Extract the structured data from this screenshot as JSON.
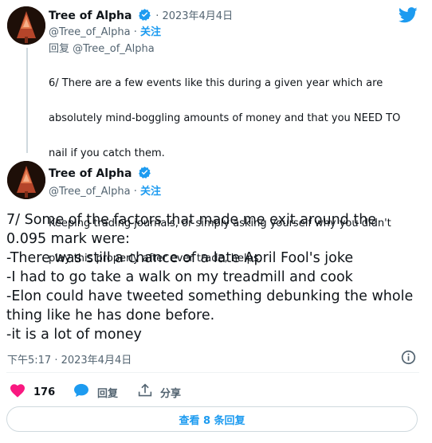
{
  "reply_tweet": {
    "author_name": "Tree of Alpha",
    "handle": "@Tree_of_Alpha",
    "date": "2023年4月4日",
    "follow_label": "关注",
    "replying_to_label": "回复",
    "replying_to_handle": "@Tree_of_Alpha",
    "text_lines": [
      "6/ There are a few events like this during a given year which are",
      "absolutely mind-boggling amounts of money and that you NEED TO",
      "nail if you catch them.",
      "",
      "Keeping trading journals, or simply asking yourself why you didn't",
      "play this properly after ever trade, helps."
    ]
  },
  "main_tweet": {
    "author_name": "Tree of Alpha",
    "handle": "@Tree_of_Alpha",
    "follow_label": "关注",
    "text_lines": [
      "7/ Some of the factors that made me exit around the",
      "0.095 mark were:",
      "-There was still a chance of a late April Fool's joke",
      "-I had to go take a walk on my treadmill and cook",
      "-Elon could have tweeted something debunking the whole",
      "thing like he has done before.",
      "-it is a lot of money"
    ],
    "timestamp": "下午5:17 · 2023年4月4日",
    "likes_count": "176",
    "reply_label": "回复",
    "share_label": "分享",
    "view_replies_label": "查看 8 条回复"
  },
  "icons": {
    "brand": "twitter-bird-icon",
    "verified": "verified-badge-icon",
    "info": "info-icon",
    "like": "heart-icon",
    "reply": "speech-bubble-icon",
    "share": "share-upload-icon"
  },
  "colors": {
    "accent": "#1d9bf0",
    "like": "#f91880",
    "text": "#0f1419",
    "muted": "#536471"
  }
}
